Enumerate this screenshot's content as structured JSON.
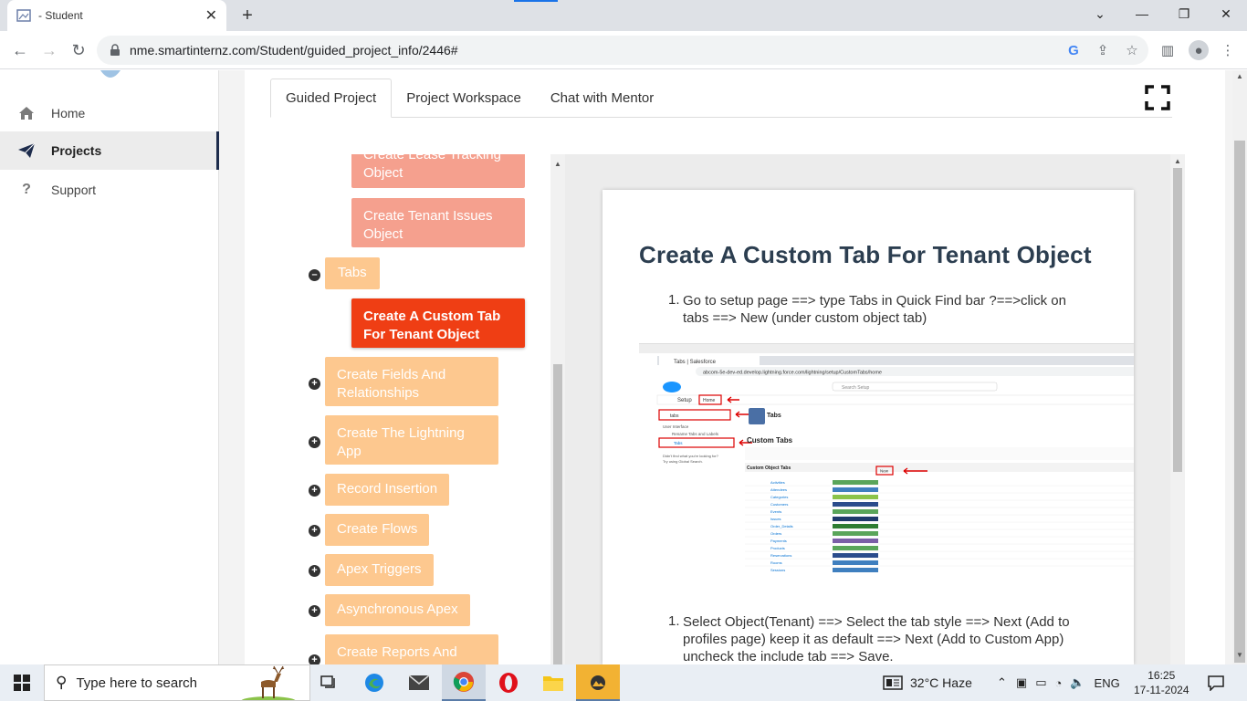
{
  "browser": {
    "tab_title": "- Student",
    "url": "nme.smartinternz.com/Student/guided_project_info/2446#"
  },
  "sidebar": {
    "items": [
      {
        "label": "Home",
        "icon": "home-icon"
      },
      {
        "label": "Projects",
        "icon": "paper-plane-icon",
        "active": true
      },
      {
        "label": "Support",
        "icon": "question-icon"
      }
    ]
  },
  "main": {
    "tabs": [
      {
        "label": "Guided Project",
        "active": true
      },
      {
        "label": "Project Workspace"
      },
      {
        "label": "Chat with Mentor"
      }
    ]
  },
  "tree": {
    "nodes": [
      {
        "label": "Create Lease Tracking Object",
        "level": 2
      },
      {
        "label": "Create Tenant Issues Object",
        "level": 2
      },
      {
        "label": "Tabs",
        "level": 1,
        "expanded": true
      },
      {
        "label": "Create A Custom Tab For Tenant Object",
        "level": 2,
        "current": true
      },
      {
        "label": "Create Fields And Relationships",
        "level": 1
      },
      {
        "label": "Create The Lightning App",
        "level": 1
      },
      {
        "label": "Record Insertion",
        "level": 1
      },
      {
        "label": "Create Flows",
        "level": 1
      },
      {
        "label": "Apex Triggers",
        "level": 1
      },
      {
        "label": "Asynchronous Apex",
        "level": 1
      },
      {
        "label": "Create Reports And Dashboards",
        "level": 1
      }
    ]
  },
  "document": {
    "title": "Create A Custom Tab For Tenant Object",
    "steps": [
      {
        "num": "1.",
        "text": "Go to setup page ==> type Tabs in Quick Find bar ?==>click on tabs ==> New (under custom object tab)"
      },
      {
        "num": "1.",
        "text": "Select Object(Tenant) ==> Select the tab style ==> Next (Add to profiles page) keep it as default ==> Next (Add to Custom App)  uncheck the include tab ==>  Save."
      }
    ],
    "screenshot": {
      "tab": "Tabs | Salesforce",
      "url": "abcom-5e-dev-ed.develop.lightning.force.com/lightning/setup/CustomTabs/home",
      "search": "Search Setup",
      "quickfind": "tabs",
      "heading": "Custom Tabs",
      "section": "Custom Object Tabs",
      "new_button": "New",
      "rows": [
        "Activities",
        "Attendees",
        "Categories",
        "Customers",
        "Events",
        "Issues",
        "Order_Details",
        "Orders",
        "Payments",
        "Products",
        "Reservations",
        "Rooms",
        "Sessions"
      ]
    }
  },
  "taskbar": {
    "search_placeholder": "Type here to search",
    "weather": "32°C  Haze",
    "lang": "ENG",
    "time": "16:25",
    "date": "17-11-2024"
  }
}
